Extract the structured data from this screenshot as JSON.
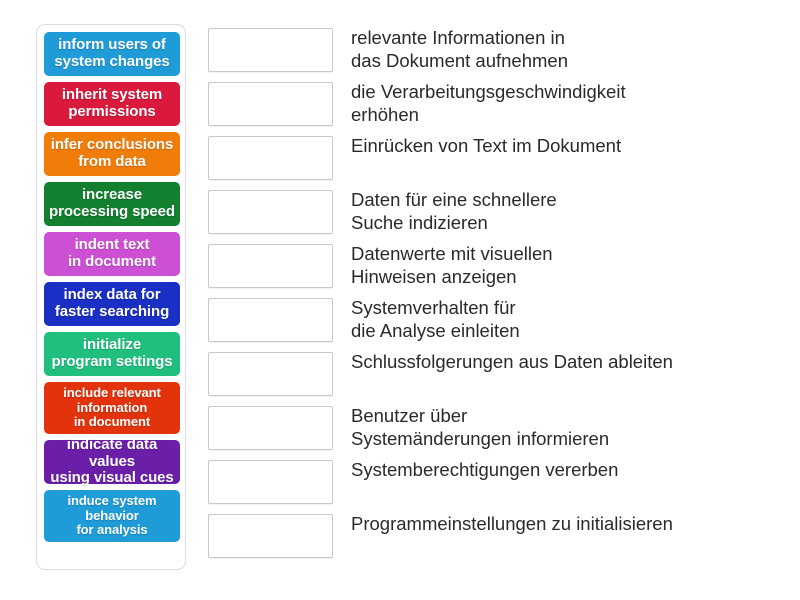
{
  "activity": {
    "type": "match-up",
    "language": "de"
  },
  "tiles_panel": {
    "name": "draggable-terms",
    "tiles": [
      {
        "label": "inform users of\nsystem changes",
        "color": "#1f9bd8",
        "lines": 2
      },
      {
        "label": "inherit system\npermissions",
        "color": "#d91a3c",
        "lines": 2
      },
      {
        "label": "infer conclusions\nfrom data",
        "color": "#f07c0a",
        "lines": 2
      },
      {
        "label": "increase\nprocessing speed",
        "color": "#13802f",
        "lines": 2
      },
      {
        "label": "indent text\nin document",
        "color": "#cc4fd4",
        "lines": 2
      },
      {
        "label": "index data for\nfaster searching",
        "color": "#1a2fc4",
        "lines": 2
      },
      {
        "label": "initialize\nprogram settings",
        "color": "#20bf7e",
        "lines": 2
      },
      {
        "label": "include relevant\ninformation\nin document",
        "color": "#e2330c",
        "lines": 3
      },
      {
        "label": "indicate data values\nusing visual cues",
        "color": "#6b1fa8",
        "lines": 2
      },
      {
        "label": "induce system\nbehavior\nfor analysis",
        "color": "#1f9bd8",
        "lines": 3
      }
    ]
  },
  "answers": {
    "name": "definition-targets",
    "rows": [
      {
        "dropzone_value": "",
        "text": "relevante Informationen in\ndas Dokument aufnehmen"
      },
      {
        "dropzone_value": "",
        "text": "die Verarbeitungsgeschwindigkeit\nerhöhen"
      },
      {
        "dropzone_value": "",
        "text": "Einrücken von Text im Dokument"
      },
      {
        "dropzone_value": "",
        "text": "Daten für eine schnellere\nSuche indizieren"
      },
      {
        "dropzone_value": "",
        "text": "Datenwerte mit visuellen\nHinweisen anzeigen"
      },
      {
        "dropzone_value": "",
        "text": "Systemverhalten für\ndie Analyse einleiten"
      },
      {
        "dropzone_value": "",
        "text": "Schlussfolgerungen aus Daten ableiten"
      },
      {
        "dropzone_value": "",
        "text": "Benutzer über\nSystemänderungen informieren"
      },
      {
        "dropzone_value": "",
        "text": "Systemberechtigungen vererben"
      },
      {
        "dropzone_value": "",
        "text": "Programmeinstellungen zu initialisieren"
      }
    ]
  },
  "colors": {
    "panel_border": "#dcdcdc",
    "dropzone_border": "#c9c9c9",
    "text": "#2a2a2a",
    "background": "#ffffff"
  }
}
